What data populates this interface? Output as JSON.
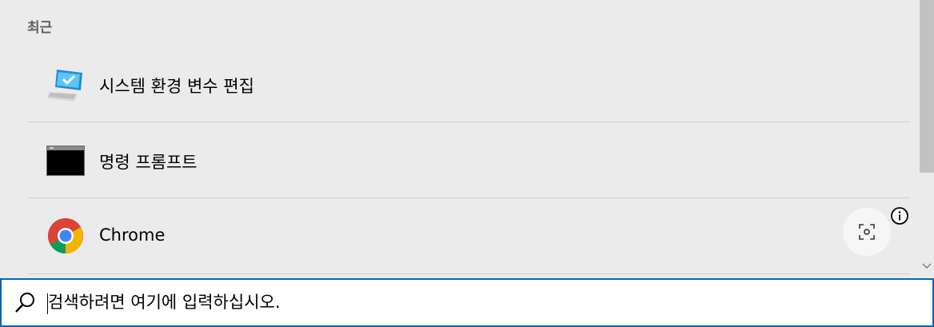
{
  "recent": {
    "header": "최근",
    "items": [
      {
        "label": "시스템 환경 변수 편집",
        "icon": "system-properties-icon"
      },
      {
        "label": "명령 프롬프트",
        "icon": "command-prompt-icon"
      },
      {
        "label": "Chrome",
        "icon": "chrome-icon"
      }
    ]
  },
  "search": {
    "value": "",
    "placeholder": "검색하려면 여기에 입력하십시오."
  },
  "colors": {
    "panel_bg": "#ebebeb",
    "search_border": "#0a64b4",
    "divider": "#cfcfcf"
  }
}
